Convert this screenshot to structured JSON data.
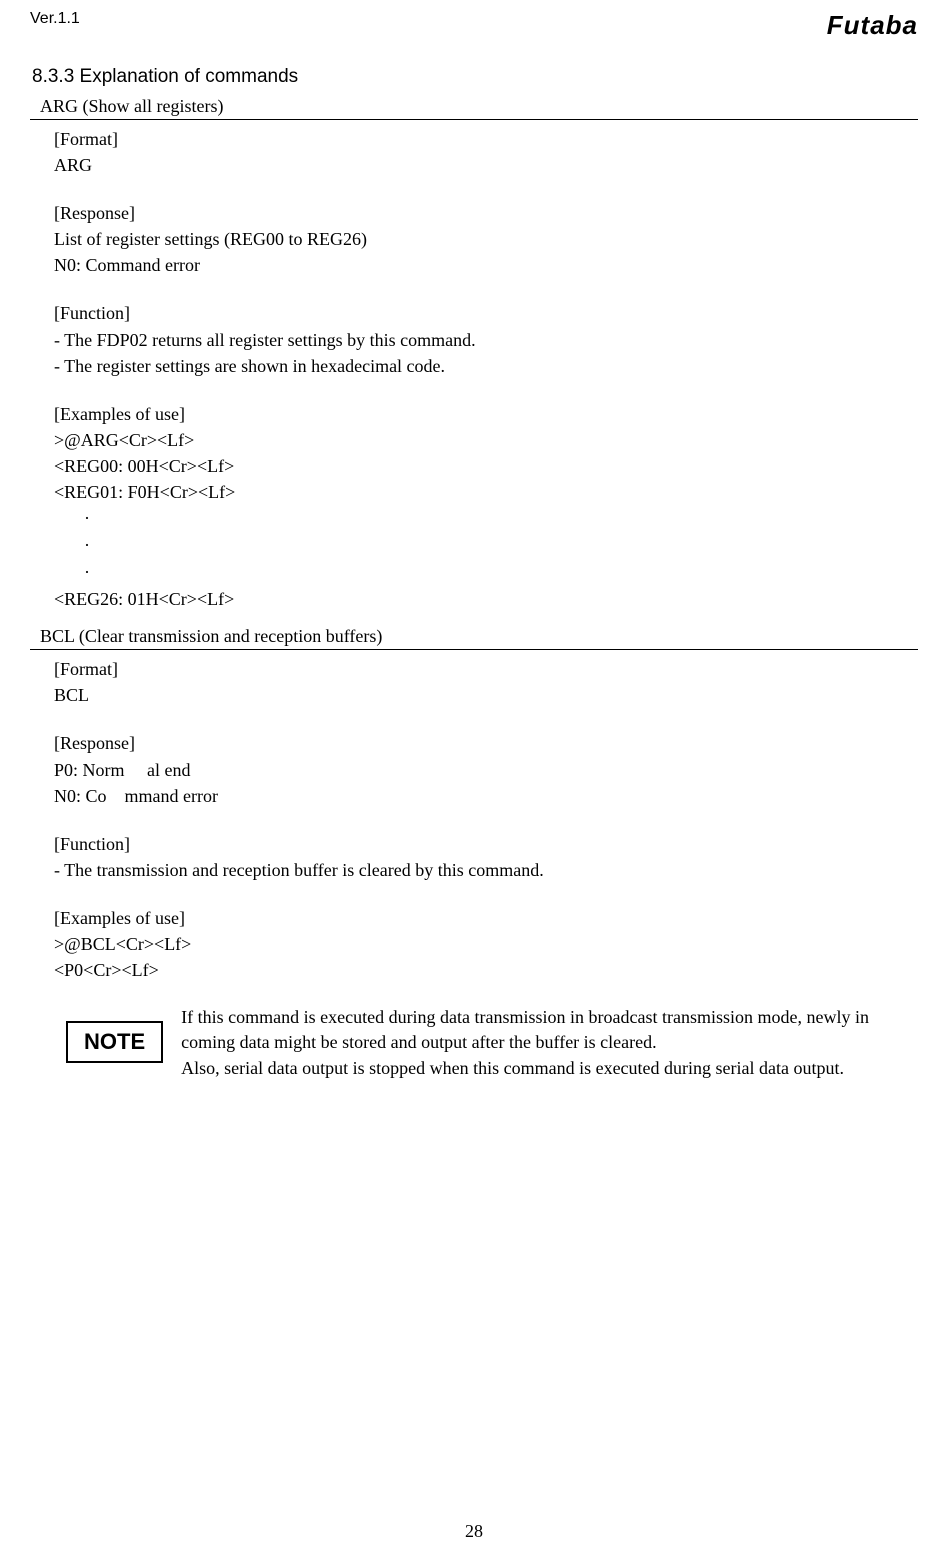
{
  "header": {
    "version": "Ver.1.1",
    "logo": "Futaba"
  },
  "section": {
    "number_title": "8.3.3    Explanation of commands"
  },
  "commands": [
    {
      "header": "ARG (Show all registers)",
      "format_label": "[Format]",
      "format_value": "ARG",
      "response_label": "[Response]",
      "response_lines": [
        "List of register settings (REG00 to REG26)",
        "N0: Command error"
      ],
      "function_label": "[Function]",
      "function_lines": [
        "- The FDP02 returns all register settings by this command.",
        "- The register settings are shown in hexadecimal code."
      ],
      "examples_label": "[Examples of use]",
      "examples_lines_top": [
        ">@ARG<Cr><Lf>",
        "<REG00: 00H<Cr><Lf>",
        "<REG01: F0H<Cr><Lf>"
      ],
      "dots": [
        "·",
        "·",
        "·"
      ],
      "examples_lines_bottom": [
        "<REG26: 01H<Cr><Lf>"
      ]
    },
    {
      "header": "BCL (Clear transmission and reception buffers)",
      "format_label": "[Format]",
      "format_value": "BCL",
      "response_label": "[Response]",
      "response_lines": [
        "P0: Norm     al end",
        "N0: Co    mmand error"
      ],
      "function_label": "[Function]",
      "function_lines": [
        "- The transmission and reception buffer is cleared by this command."
      ],
      "examples_label": "[Examples of use]",
      "examples_lines_top": [
        ">@BCL<Cr><Lf>",
        "<P0<Cr><Lf>"
      ]
    }
  ],
  "note": {
    "label": "NOTE",
    "text": "If this command is executed during data transmission in broadcast transmission mode, newly in coming data might be stored and output after the buffer is cleared.\nAlso, serial data output is stopped when this command is executed during serial data output."
  },
  "page_number": "28"
}
